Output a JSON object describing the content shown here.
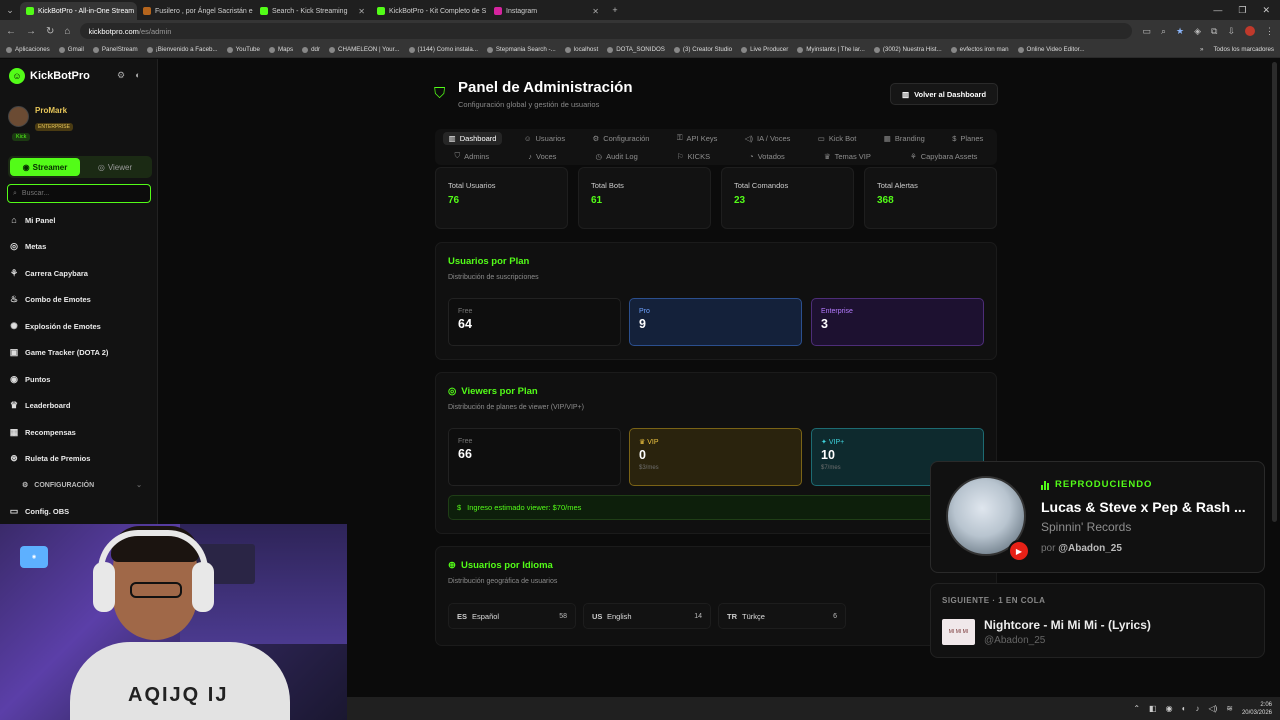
{
  "browser": {
    "tabs": [
      {
        "title": "KickBotPro - All-in-One Stream",
        "color": "#53fc18",
        "active": true
      },
      {
        "title": "Fusilero , por Ángel Sacristán e",
        "color": "#b5651d",
        "active": false
      },
      {
        "title": "Search - Kick Streaming",
        "color": "#53fc18",
        "active": false
      },
      {
        "title": "KickBotPro - Kit Completo de S",
        "color": "#53fc18",
        "active": false
      },
      {
        "title": "Instagram",
        "color": "#d6249f",
        "active": false
      }
    ],
    "url_host": "kickbotpro.com",
    "url_path": "/es/admin",
    "bookmarks": [
      "Aplicaciones",
      "Gmail",
      "PanelStream",
      "¡Bienvenido a Faceb...",
      "YouTube",
      "Maps",
      "ddr",
      "CHAMELEON | Your...",
      "(1144) Como instala...",
      "Stepmania Search -...",
      "localhost",
      "DOTA_SONIDOS",
      "(3) Creator Studio",
      "Live Producer",
      "Myinstants | The lar...",
      "(3002) Nuestra Hist...",
      "evfectos iron man",
      "Online Video Editor..."
    ],
    "bookmarks_all": "Todos los marcadores"
  },
  "sidebar": {
    "brand": "KickBotPro",
    "user_name": "ProMark",
    "user_plan": "ENTERPRISE",
    "platform_badge": "Kick",
    "mode_streamer": "Streamer",
    "mode_viewer": "Viewer",
    "search_placeholder": "Buscar...",
    "items": [
      {
        "label": "Mi Panel",
        "icon": "home-icon"
      },
      {
        "label": "Metas",
        "icon": "target-icon"
      },
      {
        "label": "Carrera Capybara",
        "icon": "capybara-icon"
      },
      {
        "label": "Combo de Emotes",
        "icon": "flame-icon"
      },
      {
        "label": "Explosión de Emotes",
        "icon": "explosion-icon"
      },
      {
        "label": "Game Tracker (DOTA 2)",
        "icon": "gamepad-icon"
      },
      {
        "label": "Puntos",
        "icon": "coins-icon"
      },
      {
        "label": "Leaderboard",
        "icon": "trophy-icon"
      },
      {
        "label": "Recompensas",
        "icon": "gift-icon"
      },
      {
        "label": "Ruleta de Premios",
        "icon": "wheel-icon"
      }
    ],
    "section_label": "CONFIGURACIÓN",
    "config_item": "Config. OBS"
  },
  "header": {
    "title": "Panel de Administración",
    "subtitle": "Configuración global y gestión de usuarios",
    "back_button": "Volver al Dashboard"
  },
  "tabs_row1": [
    "Dashboard",
    "Usuarios",
    "Configuración",
    "API Keys",
    "IA / Voces",
    "Kick Bot",
    "Branding",
    "Planes"
  ],
  "tabs_row2": [
    "Admins",
    "Voces",
    "Audit Log",
    "KICKS",
    "Votados",
    "Temas VIP",
    "Capybara Assets"
  ],
  "stats": [
    {
      "label": "Total Usuarios",
      "value": "76"
    },
    {
      "label": "Total Bots",
      "value": "61"
    },
    {
      "label": "Total Comandos",
      "value": "23"
    },
    {
      "label": "Total Alertas",
      "value": "368"
    }
  ],
  "users_by_plan": {
    "title": "Usuarios por Plan",
    "subtitle": "Distribución de suscripciones",
    "free_label": "Free",
    "free_value": "64",
    "pro_label": "Pro",
    "pro_value": "9",
    "ent_label": "Enterprise",
    "ent_value": "3"
  },
  "viewers_by_plan": {
    "title": "Viewers por Plan",
    "subtitle": "Distribución de planes de viewer (VIP/VIP+)",
    "free_label": "Free",
    "free_value": "66",
    "vip_label": "VIP",
    "vip_value": "0",
    "vip_price": "$3/mes",
    "vipp_label": "VIP+",
    "vipp_value": "10",
    "vipp_price": "$7/mes",
    "income": "Ingreso estimado viewer: $70/mes"
  },
  "users_by_language": {
    "title": "Usuarios por Idioma",
    "subtitle": "Distribución geográfica de usuarios",
    "langs": [
      {
        "code": "ES",
        "name": "Español",
        "count": "58"
      },
      {
        "code": "US",
        "name": "English",
        "count": "14"
      },
      {
        "code": "TR",
        "name": "Türkçe",
        "count": "6"
      }
    ]
  },
  "now_playing": {
    "tag": "REPRODUCIENDO",
    "title": "Lucas & Steve x Pep & Rash ...",
    "artist": "Spinnin' Records",
    "by_prefix": "por",
    "by_user": "@Abadon_25"
  },
  "queue": {
    "header": "SIGUIENTE · 1 EN COLA",
    "title": "Nightcore - Mi Mi Mi - (Lyrics)",
    "by": "@Abadon_25",
    "thumb_text": "MI MI MI"
  },
  "webcam": {
    "shirt_text": "AQIJQ IJ"
  },
  "taskbar": {
    "time": "2:06",
    "date": "20/03/2026"
  },
  "colors": {
    "accent": "#53fc18",
    "pro": "#6ea2ff",
    "enterprise": "#b57bff",
    "vip": "#f0c541",
    "vipplus": "#3fd4dd"
  }
}
